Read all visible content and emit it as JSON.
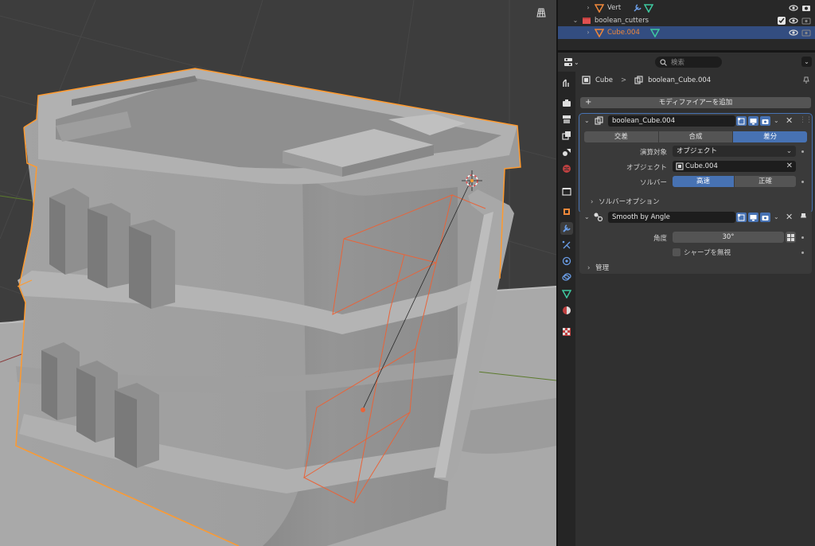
{
  "outliner": {
    "rows": [
      {
        "label": "Vert"
      },
      {
        "label": "boolean_cutters"
      },
      {
        "label": "Cube.004"
      }
    ]
  },
  "header": {
    "search_placeholder": "検索"
  },
  "breadcrumb": {
    "object": "Cube",
    "separator": ">",
    "modifier": "boolean_Cube.004"
  },
  "add_modifier_label": "モディファイアーを追加",
  "boolean_modifier": {
    "name": "boolean_Cube.004",
    "operations": [
      "交差",
      "合成",
      "差分"
    ],
    "active_operation": "差分",
    "operand_label": "演算対象",
    "operand_value": "オブジェクト",
    "object_label": "オブジェクト",
    "object_value": "Cube.004",
    "solver_label": "ソルバー",
    "solvers": [
      "高速",
      "正確"
    ],
    "active_solver": "高速",
    "solver_options_label": "ソルバーオプション"
  },
  "smooth_modifier": {
    "name": "Smooth by Angle",
    "angle_label": "角度",
    "angle_value": "30°",
    "ignore_sharp_label": "シャープを無視",
    "manage_label": "管理"
  },
  "colors": {
    "accent": "#4772b3",
    "selection_outline": "#ff9a2e",
    "cutter_outline": "#e8643a",
    "panel_bg": "#303030",
    "viewport_bg": "#3d3d3d"
  }
}
